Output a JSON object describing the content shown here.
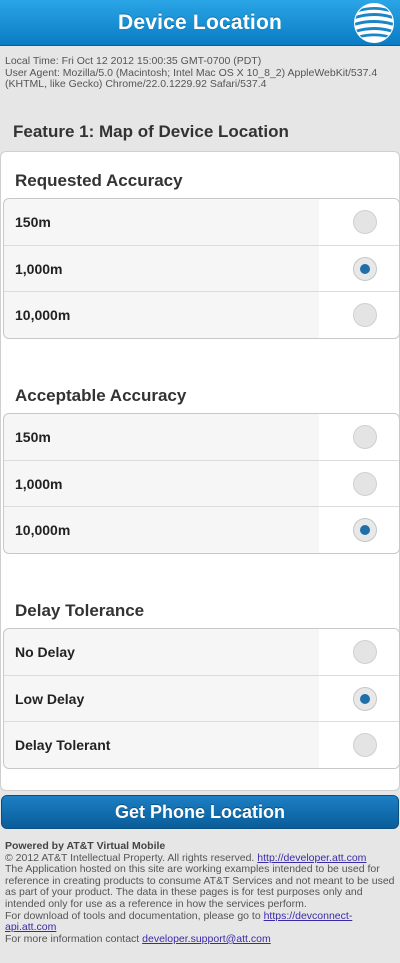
{
  "header": {
    "title": "Device Location",
    "logo_icon": "att-globe-logo",
    "brand_color": "#0a7cc4"
  },
  "meta": {
    "local_time": "Local Time: Fri Oct 12 2012 15:00:35 GMT-0700 (PDT)",
    "user_agent_line1": "User Agent: Mozilla/5.0 (Macintosh; Intel Mac OS X 10_8_2) AppleWebKit/537.4",
    "user_agent_line2": "(KHTML, like Gecko) Chrome/22.0.1229.92 Safari/537.4"
  },
  "feature": {
    "title": "Feature 1: Map of Device Location"
  },
  "groups": [
    {
      "title": "Requested Accuracy",
      "options": [
        {
          "label": "150m",
          "selected": false
        },
        {
          "label": "1,000m",
          "selected": true
        },
        {
          "label": "10,000m",
          "selected": false
        }
      ]
    },
    {
      "title": "Acceptable Accuracy",
      "options": [
        {
          "label": "150m",
          "selected": false
        },
        {
          "label": "1,000m",
          "selected": false
        },
        {
          "label": "10,000m",
          "selected": true
        }
      ]
    },
    {
      "title": "Delay Tolerance",
      "options": [
        {
          "label": "No Delay",
          "selected": false
        },
        {
          "label": "Low Delay",
          "selected": true
        },
        {
          "label": "Delay Tolerant",
          "selected": false
        }
      ]
    }
  ],
  "action": {
    "label": "Get Phone Location"
  },
  "footer": {
    "powered_by": "Powered by AT&T Virtual Mobile",
    "copyright": "© 2012 AT&T Intellectual Property. All rights reserved.",
    "developer_link": "http://developer.att.com",
    "disclaimer": "The Application hosted on this site are working examples intended to be used for reference in creating products to consume AT&T Services and not meant to be used as part of your product. The data in these pages is for test purposes only and intended only for use as a reference in how the services perform.",
    "download_text": "For download of tools and documentation, please go to",
    "devconnect_link": "https://devconnect-api.att.com",
    "contact_text": "For more information contact",
    "support_email": "developer.support@att.com"
  }
}
